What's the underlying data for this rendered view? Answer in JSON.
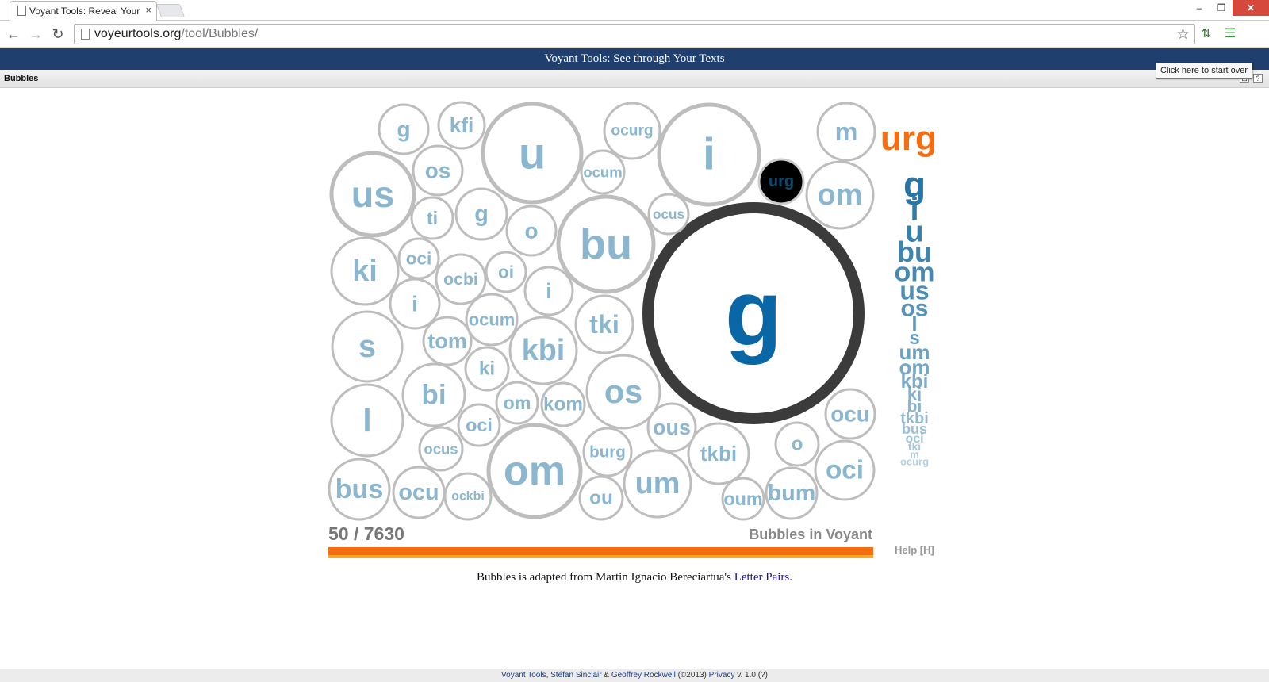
{
  "browser": {
    "tab_title": "Voyant Tools: Reveal Your",
    "tab_close": "×",
    "url_domain": "voyeurtools.org",
    "url_path": "/tool/Bubbles/",
    "window_controls": [
      "–",
      "❐",
      "✕"
    ]
  },
  "header": {
    "title": "Voyant Tools: See through Your Texts"
  },
  "panel": {
    "title": "Bubbles",
    "buttons": [
      "⊟",
      "?"
    ],
    "tooltip": "Click here to start over"
  },
  "bubbles": [
    {
      "label": "g",
      "highlight": "dark"
    },
    {
      "label": "urg",
      "highlight": "black"
    },
    {
      "label": "u"
    },
    {
      "label": "i"
    },
    {
      "label": "bu"
    },
    {
      "label": "us"
    },
    {
      "label": "om"
    },
    {
      "label": "os"
    },
    {
      "label": "s"
    },
    {
      "label": "l"
    },
    {
      "label": "ki"
    },
    {
      "label": "bi"
    },
    {
      "label": "bus"
    },
    {
      "label": "kbi"
    },
    {
      "label": "um"
    },
    {
      "label": "tkbi"
    },
    {
      "label": "om"
    },
    {
      "label": "m"
    },
    {
      "label": "ocurg"
    },
    {
      "label": "g"
    },
    {
      "label": "kfi"
    },
    {
      "label": "os"
    },
    {
      "label": "ocum"
    },
    {
      "label": "ti"
    },
    {
      "label": "g"
    },
    {
      "label": "o"
    },
    {
      "label": "ocus"
    },
    {
      "label": "oci"
    },
    {
      "label": "ocbi"
    },
    {
      "label": "oi"
    },
    {
      "label": "i"
    },
    {
      "label": "i"
    },
    {
      "label": "ocum"
    },
    {
      "label": "tom"
    },
    {
      "label": "tki"
    },
    {
      "label": "ki"
    },
    {
      "label": "om"
    },
    {
      "label": "kom"
    },
    {
      "label": "oci"
    },
    {
      "label": "ocus"
    },
    {
      "label": "burg"
    },
    {
      "label": "ocu"
    },
    {
      "label": "ockbi"
    },
    {
      "label": "ou"
    },
    {
      "label": "ocu"
    },
    {
      "label": "oci"
    },
    {
      "label": "o"
    },
    {
      "label": "oum"
    },
    {
      "label": "bum"
    },
    {
      "label": "ous"
    }
  ],
  "current_word": "urg",
  "stats": {
    "counter": "50 / 7630",
    "label": "Bubbles in Voyant"
  },
  "word_list": [
    "g",
    "i",
    "u",
    "bu",
    "om",
    "us",
    "os",
    "l",
    "s",
    "um",
    "om",
    "kbi",
    "ki",
    "bi",
    "tkbi",
    "bus",
    "oci",
    "tki",
    "m",
    "ocurg"
  ],
  "help": "Help [H]",
  "credit": {
    "prefix": "Bubbles is adapted from Martin Ignacio Bereciartua's ",
    "link": "Letter Pairs",
    "suffix": "."
  },
  "footer": {
    "voyant": "Voyant Tools",
    "sep1": ", ",
    "author1": "Stéfan Sinclair",
    "amp": " & ",
    "author2": "Geoffrey Rockwell",
    "copy": " (©2013) ",
    "privacy": "Privacy",
    "version": " v. 1.0 (?)"
  },
  "colors": {
    "header": "#1f3f6e",
    "accent": "#f46d10",
    "bubble_text": "#8ab6cf",
    "word_list": "#2776a7"
  }
}
